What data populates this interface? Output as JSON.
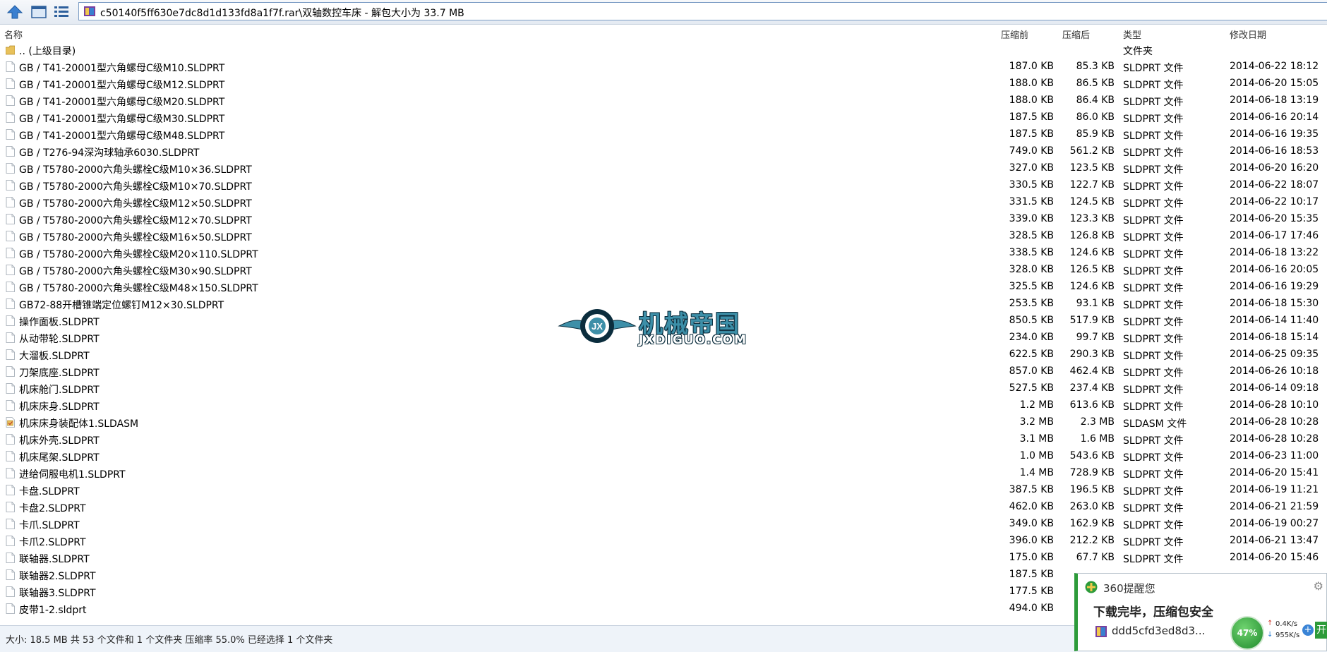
{
  "toolbar": {
    "path": "c50140f5ff630e7dc8d1d133fd8a1f7f.rar\\双轴数控车床 - 解包大小为 33.7 MB"
  },
  "columns": {
    "name": "名称",
    "before": "压缩前",
    "after": "压缩后",
    "type": "类型",
    "date": "修改日期"
  },
  "rows": [
    {
      "name": ".. (上级目录)",
      "before": "",
      "after": "",
      "type": "文件夹",
      "date": "",
      "kind": "folder"
    },
    {
      "name": "GB / T41-20001型六角螺母C级M10.SLDPRT",
      "before": "187.0 KB",
      "after": "85.3 KB",
      "type": "SLDPRT 文件",
      "date": "2014-06-22 18:12",
      "kind": "file"
    },
    {
      "name": "GB / T41-20001型六角螺母C级M12.SLDPRT",
      "before": "188.0 KB",
      "after": "86.5 KB",
      "type": "SLDPRT 文件",
      "date": "2014-06-20 15:05",
      "kind": "file"
    },
    {
      "name": "GB / T41-20001型六角螺母C级M20.SLDPRT",
      "before": "188.0 KB",
      "after": "86.4 KB",
      "type": "SLDPRT 文件",
      "date": "2014-06-18 13:19",
      "kind": "file"
    },
    {
      "name": "GB / T41-20001型六角螺母C级M30.SLDPRT",
      "before": "187.5 KB",
      "after": "86.0 KB",
      "type": "SLDPRT 文件",
      "date": "2014-06-16 20:14",
      "kind": "file"
    },
    {
      "name": "GB / T41-20001型六角螺母C级M48.SLDPRT",
      "before": "187.5 KB",
      "after": "85.9 KB",
      "type": "SLDPRT 文件",
      "date": "2014-06-16 19:35",
      "kind": "file"
    },
    {
      "name": "GB / T276-94深沟球轴承6030.SLDPRT",
      "before": "749.0 KB",
      "after": "561.2 KB",
      "type": "SLDPRT 文件",
      "date": "2014-06-16 18:53",
      "kind": "file"
    },
    {
      "name": "GB / T5780-2000六角头螺栓C级M10×36.SLDPRT",
      "before": "327.0 KB",
      "after": "123.5 KB",
      "type": "SLDPRT 文件",
      "date": "2014-06-20 16:20",
      "kind": "file"
    },
    {
      "name": "GB / T5780-2000六角头螺栓C级M10×70.SLDPRT",
      "before": "330.5 KB",
      "after": "122.7 KB",
      "type": "SLDPRT 文件",
      "date": "2014-06-22 18:07",
      "kind": "file"
    },
    {
      "name": "GB / T5780-2000六角头螺栓C级M12×50.SLDPRT",
      "before": "331.5 KB",
      "after": "124.5 KB",
      "type": "SLDPRT 文件",
      "date": "2014-06-22 10:17",
      "kind": "file"
    },
    {
      "name": "GB / T5780-2000六角头螺栓C级M12×70.SLDPRT",
      "before": "339.0 KB",
      "after": "123.3 KB",
      "type": "SLDPRT 文件",
      "date": "2014-06-20 15:35",
      "kind": "file"
    },
    {
      "name": "GB / T5780-2000六角头螺栓C级M16×50.SLDPRT",
      "before": "328.5 KB",
      "after": "126.8 KB",
      "type": "SLDPRT 文件",
      "date": "2014-06-17 17:46",
      "kind": "file"
    },
    {
      "name": "GB / T5780-2000六角头螺栓C级M20×110.SLDPRT",
      "before": "338.5 KB",
      "after": "124.6 KB",
      "type": "SLDPRT 文件",
      "date": "2014-06-18 13:22",
      "kind": "file"
    },
    {
      "name": "GB / T5780-2000六角头螺栓C级M30×90.SLDPRT",
      "before": "328.0 KB",
      "after": "126.5 KB",
      "type": "SLDPRT 文件",
      "date": "2014-06-16 20:05",
      "kind": "file"
    },
    {
      "name": "GB / T5780-2000六角头螺栓C级M48×150.SLDPRT",
      "before": "325.5 KB",
      "after": "124.6 KB",
      "type": "SLDPRT 文件",
      "date": "2014-06-16 19:29",
      "kind": "file"
    },
    {
      "name": "GB72-88开槽锥端定位螺钉M12×30.SLDPRT",
      "before": "253.5 KB",
      "after": "93.1 KB",
      "type": "SLDPRT 文件",
      "date": "2014-06-18 15:30",
      "kind": "file"
    },
    {
      "name": "操作面板.SLDPRT",
      "before": "850.5 KB",
      "after": "517.9 KB",
      "type": "SLDPRT 文件",
      "date": "2014-06-14 11:40",
      "kind": "file"
    },
    {
      "name": "从动带轮.SLDPRT",
      "before": "234.0 KB",
      "after": "99.7 KB",
      "type": "SLDPRT 文件",
      "date": "2014-06-18 15:14",
      "kind": "file"
    },
    {
      "name": "大溜板.SLDPRT",
      "before": "622.5 KB",
      "after": "290.3 KB",
      "type": "SLDPRT 文件",
      "date": "2014-06-25 09:35",
      "kind": "file"
    },
    {
      "name": "刀架底座.SLDPRT",
      "before": "857.0 KB",
      "after": "462.4 KB",
      "type": "SLDPRT 文件",
      "date": "2014-06-26 10:18",
      "kind": "file"
    },
    {
      "name": "机床舱门.SLDPRT",
      "before": "527.5 KB",
      "after": "237.4 KB",
      "type": "SLDPRT 文件",
      "date": "2014-06-14 09:18",
      "kind": "file"
    },
    {
      "name": "机床床身.SLDPRT",
      "before": "1.2 MB",
      "after": "613.6 KB",
      "type": "SLDPRT 文件",
      "date": "2014-06-28 10:10",
      "kind": "file"
    },
    {
      "name": "机床床身装配体1.SLDASM",
      "before": "3.2 MB",
      "after": "2.3 MB",
      "type": "SLDASM 文件",
      "date": "2014-06-28 10:28",
      "kind": "asm"
    },
    {
      "name": "机床外壳.SLDPRT",
      "before": "3.1 MB",
      "after": "1.6 MB",
      "type": "SLDPRT 文件",
      "date": "2014-06-28 10:28",
      "kind": "file"
    },
    {
      "name": "机床尾架.SLDPRT",
      "before": "1.0 MB",
      "after": "543.6 KB",
      "type": "SLDPRT 文件",
      "date": "2014-06-23 11:00",
      "kind": "file"
    },
    {
      "name": "进给伺服电机1.SLDPRT",
      "before": "1.4 MB",
      "after": "728.9 KB",
      "type": "SLDPRT 文件",
      "date": "2014-06-20 15:41",
      "kind": "file"
    },
    {
      "name": "卡盘.SLDPRT",
      "before": "387.5 KB",
      "after": "196.5 KB",
      "type": "SLDPRT 文件",
      "date": "2014-06-19 11:21",
      "kind": "file"
    },
    {
      "name": "卡盘2.SLDPRT",
      "before": "462.0 KB",
      "after": "263.0 KB",
      "type": "SLDPRT 文件",
      "date": "2014-06-21 21:59",
      "kind": "file"
    },
    {
      "name": "卡爪.SLDPRT",
      "before": "349.0 KB",
      "after": "162.9 KB",
      "type": "SLDPRT 文件",
      "date": "2014-06-19 00:27",
      "kind": "file"
    },
    {
      "name": "卡爪2.SLDPRT",
      "before": "396.0 KB",
      "after": "212.2 KB",
      "type": "SLDPRT 文件",
      "date": "2014-06-21 13:47",
      "kind": "file"
    },
    {
      "name": "联轴器.SLDPRT",
      "before": "175.0 KB",
      "after": "67.7 KB",
      "type": "SLDPRT 文件",
      "date": "2014-06-20 15:46",
      "kind": "file"
    },
    {
      "name": "联轴器2.SLDPRT",
      "before": "187.5 KB",
      "after": "",
      "type": "",
      "date": "",
      "kind": "file"
    },
    {
      "name": "联轴器3.SLDPRT",
      "before": "177.5 KB",
      "after": "",
      "type": "",
      "date": "",
      "kind": "file"
    },
    {
      "name": "皮带1-2.sldprt",
      "before": "494.0 KB",
      "after": "",
      "type": "",
      "date": "",
      "kind": "file"
    }
  ],
  "status": {
    "text": "大小: 18.5 MB 共 53 个文件和 1 个文件夹 压缩率 55.0% 已经选择 1 个文件夹"
  },
  "watermark": {
    "title": "机械帝国",
    "sub": "JXDIGUO.COM"
  },
  "popup": {
    "title": "360提醒您",
    "message": "下载完毕，压缩包安全",
    "file": "ddd5cfd3ed8d3...",
    "progress_label": "47%",
    "progress": 0.47,
    "upload_speed": "0.4K/s",
    "download_speed": "955K/s",
    "plus_label": "+",
    "open_label": "开"
  },
  "icons": {
    "up": "arrow-up-icon",
    "view": "window-icon",
    "list": "list-icon",
    "archive": "archive-icon",
    "folder": "folder-icon",
    "file": "file-icon",
    "asm": "assembly-icon"
  },
  "colors": {
    "accent": "#2d9b3a",
    "toolbar_border": "#7b9cc4",
    "watermark": "#3d8fa8"
  }
}
